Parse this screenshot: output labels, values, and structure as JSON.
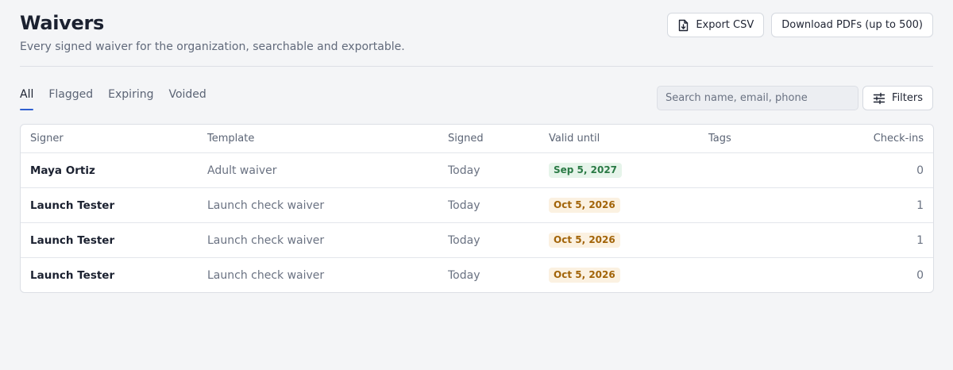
{
  "header": {
    "title": "Waivers",
    "subtitle": "Every signed waiver for the organization, searchable and exportable."
  },
  "actions": {
    "export_csv": "Export CSV",
    "download_pdfs": "Download PDFs (up to 500)"
  },
  "tabs": [
    {
      "label": "All",
      "active": true
    },
    {
      "label": "Flagged",
      "active": false
    },
    {
      "label": "Expiring",
      "active": false
    },
    {
      "label": "Voided",
      "active": false
    }
  ],
  "search": {
    "placeholder": "Search name, email, phone",
    "value": ""
  },
  "filters": {
    "label": "Filters"
  },
  "table": {
    "columns": [
      "Signer",
      "Template",
      "Signed",
      "Valid until",
      "Tags",
      "Check-ins"
    ],
    "rows": [
      {
        "signer": "Maya Ortiz",
        "template": "Adult waiver",
        "signed": "Today",
        "valid_until": "Sep 5, 2027",
        "valid_status": "green",
        "tags": "",
        "checkins": "0"
      },
      {
        "signer": "Launch Tester",
        "template": "Launch check waiver",
        "signed": "Today",
        "valid_until": "Oct 5, 2026",
        "valid_status": "amber",
        "tags": "",
        "checkins": "1"
      },
      {
        "signer": "Launch Tester",
        "template": "Launch check waiver",
        "signed": "Today",
        "valid_until": "Oct 5, 2026",
        "valid_status": "amber",
        "tags": "",
        "checkins": "1"
      },
      {
        "signer": "Launch Tester",
        "template": "Launch check waiver",
        "signed": "Today",
        "valid_until": "Oct 5, 2026",
        "valid_status": "amber",
        "tags": "",
        "checkins": "0"
      }
    ]
  },
  "colors": {
    "accent": "#2f5fd0",
    "badge_green_bg": "#e6f4ea",
    "badge_green_text": "#2a7a45",
    "badge_amber_bg": "#fbf1e1",
    "badge_amber_text": "#a26409"
  },
  "icons": {
    "export": "file-download-icon",
    "filters": "sliders-icon"
  }
}
